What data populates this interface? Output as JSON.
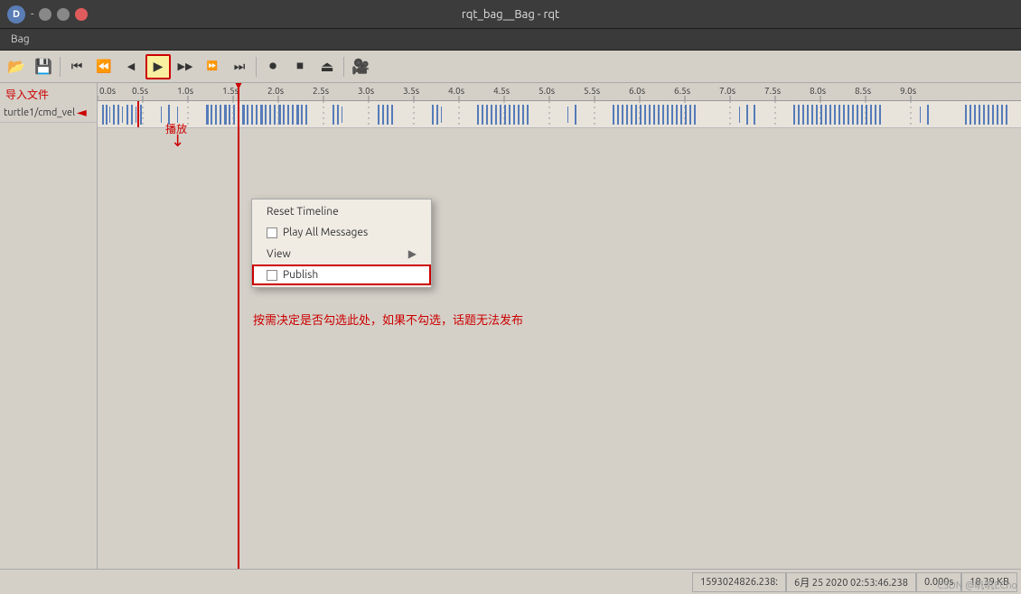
{
  "window": {
    "title": "rqt_bag__Bag - rqt",
    "titlebar_right_text": "D",
    "minimize": "–",
    "maximize": "□",
    "close": "✕"
  },
  "menubar": {
    "items": [
      "Bag"
    ]
  },
  "toolbar": {
    "buttons": [
      {
        "id": "open",
        "icon": "📂",
        "label": "Open"
      },
      {
        "id": "save",
        "icon": "💾",
        "label": "Save"
      },
      {
        "id": "start",
        "icon": "⏮",
        "label": "Go to Start"
      },
      {
        "id": "prev",
        "icon": "⏪",
        "label": "Previous"
      },
      {
        "id": "back",
        "icon": "◀",
        "label": "Back"
      },
      {
        "id": "play",
        "icon": "▶",
        "label": "Play",
        "highlighted": true
      },
      {
        "id": "forward",
        "icon": "▶",
        "label": "Forward"
      },
      {
        "id": "next",
        "icon": "⏩",
        "label": "Next"
      },
      {
        "id": "end",
        "icon": "⏭",
        "label": "Go to End"
      },
      {
        "id": "record",
        "icon": "⏺",
        "label": "Record"
      },
      {
        "id": "stop",
        "icon": "⏹",
        "label": "Stop"
      },
      {
        "id": "eject",
        "icon": "⏏",
        "label": "Eject"
      },
      {
        "id": "cam",
        "icon": "🎥",
        "label": "Camera"
      }
    ]
  },
  "annotations": {
    "play_label": "播放",
    "import_label": "导入文件",
    "chinese_note": "按需决定是否勾选此处，如果不勾选，话题无法发布"
  },
  "timeline": {
    "ticks": [
      "0.0s",
      "0.5s",
      "1.0s",
      "1.5s",
      "2.0s",
      "2.5s",
      "3.0s",
      "3.5s",
      "4.0s",
      "4.5s",
      "5.0s",
      "5.5s",
      "6.0s",
      "6.5s",
      "7.0s",
      "7.5s",
      "8.0s",
      "8.5s",
      "9.0s"
    ]
  },
  "topic": {
    "name": "turtle1/cmd_vel"
  },
  "context_menu": {
    "items": [
      {
        "id": "reset_timeline",
        "label": "Reset Timeline",
        "type": "action"
      },
      {
        "id": "play_all_messages",
        "label": "Play All Messages",
        "type": "checkbox",
        "checked": false
      },
      {
        "id": "view",
        "label": "View",
        "type": "submenu"
      },
      {
        "id": "publish",
        "label": "Publish",
        "type": "checkbox",
        "checked": false,
        "highlighted": true
      }
    ]
  },
  "statusbar": {
    "timestamp": "1593024826.238:",
    "datetime": "6月 25 2020 02:53:46.238",
    "duration": "0.000s",
    "filesize": "18.39 KB"
  },
  "watermark": "CSDN @叽叽EChо"
}
